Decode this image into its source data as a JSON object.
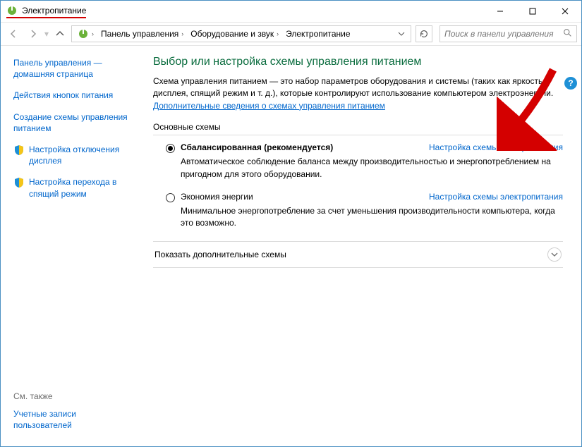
{
  "title": "Электропитание",
  "breadcrumb": {
    "seg1": "Панель управления",
    "seg2": "Оборудование и звук",
    "seg3": "Электропитание"
  },
  "search": {
    "placeholder": "Поиск в панели управления"
  },
  "sidebar": {
    "home": "Панель управления — домашняя страница",
    "actions": "Действия кнопок питания",
    "create": "Создание схемы управления питанием",
    "display": "Настройка отключения дисплея",
    "sleep": "Настройка перехода в спящий режим",
    "seealso": "См. также",
    "accounts": "Учетные записи пользователей"
  },
  "main": {
    "heading": "Выбор или настройка схемы управления питанием",
    "desc1": "Схема управления питанием — это набор параметров оборудования и системы (таких как яркость дисплея, спящий режим и т. д.), которые контролируют использование компьютером электроэнергии.",
    "moreinfo": "Дополнительные сведения о схемах управления питанием",
    "section_basic": "Основные схемы",
    "plan_balanced": {
      "name": "Сбалансированная (рекомендуется)",
      "link": "Настройка схемы электропитания",
      "desc": "Автоматическое соблюдение баланса между производительностью и энергопотреблением на пригодном для этого оборудовании."
    },
    "plan_saver": {
      "name": "Экономия энергии",
      "link": "Настройка схемы электропитания",
      "desc": "Минимальное энергопотребление за счет уменьшения производительности компьютера, когда это возможно."
    },
    "show_more": "Показать дополнительные схемы"
  }
}
